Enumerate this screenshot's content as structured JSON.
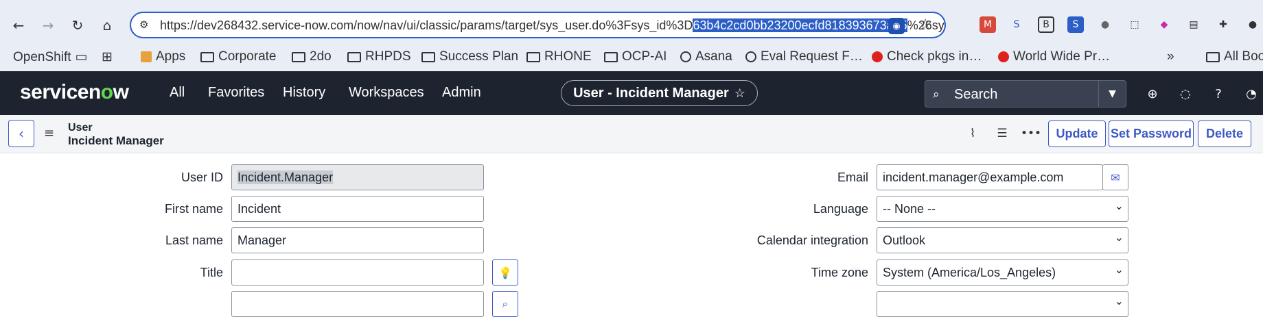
{
  "browser": {
    "url_before": "https://dev268432.service-now.com/now/nav/ui/classic/params/target/sys_user.do%3Fsys_id%3D",
    "url_highlight": "63b4c2cd0bb23200ecfd818393673a95",
    "url_after": "%26sy"
  },
  "bookmarks": {
    "openshift": "OpenShift",
    "items": [
      "Apps",
      "Corporate",
      "2do",
      "RHPDS",
      "Success Plan",
      "RHONE",
      "OCP-AI",
      "Asana",
      "Eval Request F…",
      "Check pkgs in…",
      "World Wide Pr…"
    ],
    "overflow": "»",
    "all_bookmarks": "All Boo"
  },
  "header": {
    "logo_pre": "servicen",
    "logo_o": "o",
    "logo_post": "w",
    "nav": [
      "All",
      "Favorites",
      "History",
      "Workspaces",
      "Admin"
    ],
    "context_title": "User - Incident Manager",
    "search_placeholder": "Search"
  },
  "form_header": {
    "record_type": "User",
    "record_name": "Incident Manager",
    "buttons": {
      "update": "Update",
      "set_password": "Set Password",
      "delete": "Delete"
    }
  },
  "form": {
    "left": [
      {
        "label": "User ID",
        "value": "Incident.Manager"
      },
      {
        "label": "First name",
        "value": "Incident"
      },
      {
        "label": "Last name",
        "value": "Manager"
      },
      {
        "label": "Title",
        "value": ""
      }
    ],
    "right": [
      {
        "label": "Email",
        "value": "incident.manager@example.com"
      },
      {
        "label": "Language",
        "value": "-- None --"
      },
      {
        "label": "Calendar integration",
        "value": "Outlook"
      },
      {
        "label": "Time zone",
        "value": "System (America/Los_Angeles)"
      }
    ]
  },
  "colors": {
    "accent": "#3c59c6",
    "header_bg": "#1d2430",
    "logo_green": "#62d84e"
  }
}
